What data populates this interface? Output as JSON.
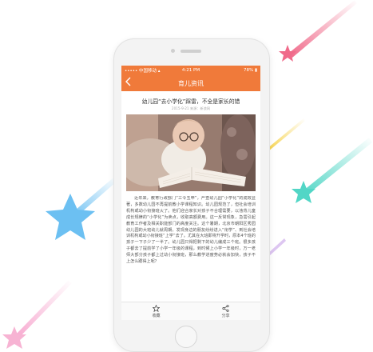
{
  "colors": {
    "accent": "#f07a3a",
    "star_blue": "#6cc0f2",
    "star_teal": "#52d6c6",
    "star_pink": "#f06a8a",
    "star_pink_light": "#f7b3d3",
    "background": "#ffffff"
  },
  "status_bar": {
    "carrier": "••••• 中国移动 ▴",
    "time": "4:21 PM",
    "battery": "78%"
  },
  "nav": {
    "title": "育儿资讯",
    "back_icon": "chevron-left-icon"
  },
  "article": {
    "title": "幼儿园“去小学化”踩雷，不全是家长的错",
    "meta": "2015-9-21   来源：新浪网",
    "body": "近年来，教育行政部门“三令五申”，严查幼儿园“小学化”的成效显著，多数幼儿园不再提前教小学课程知识。幼儿园规范了，但社会培训机构或幼小衔接班火了。他们迎合家长对孩子不合理需要，以违背儿童成长规律的“小学化”为卖点，收取高额费用。这一反常现象，急需引起教育工作者及相关职能部门的高度关注。这个暑期，北京市朝阳区秀园幼儿园的大班幼儿就周期，发现身边的朋友纷纷进入“衔学”、到社会培训机构或幼小衔接班“上学”去了。尤其在大班即将升学时，原本4个班的孩子一下子少了一半了。幼儿园只得把剩下的幼儿编成三个班。很多孩子都去了提前学了小学一年级的课程，到时候上小学一年级时，万一老师大部分孩子都上过幼小衔接班，那么教学进度势必就会加快，孩子不上怎么跟得上呢？"
  },
  "tabs": [
    {
      "label": "收藏",
      "icon": "star-outline-icon"
    },
    {
      "label": "分享",
      "icon": "share-icon"
    }
  ]
}
